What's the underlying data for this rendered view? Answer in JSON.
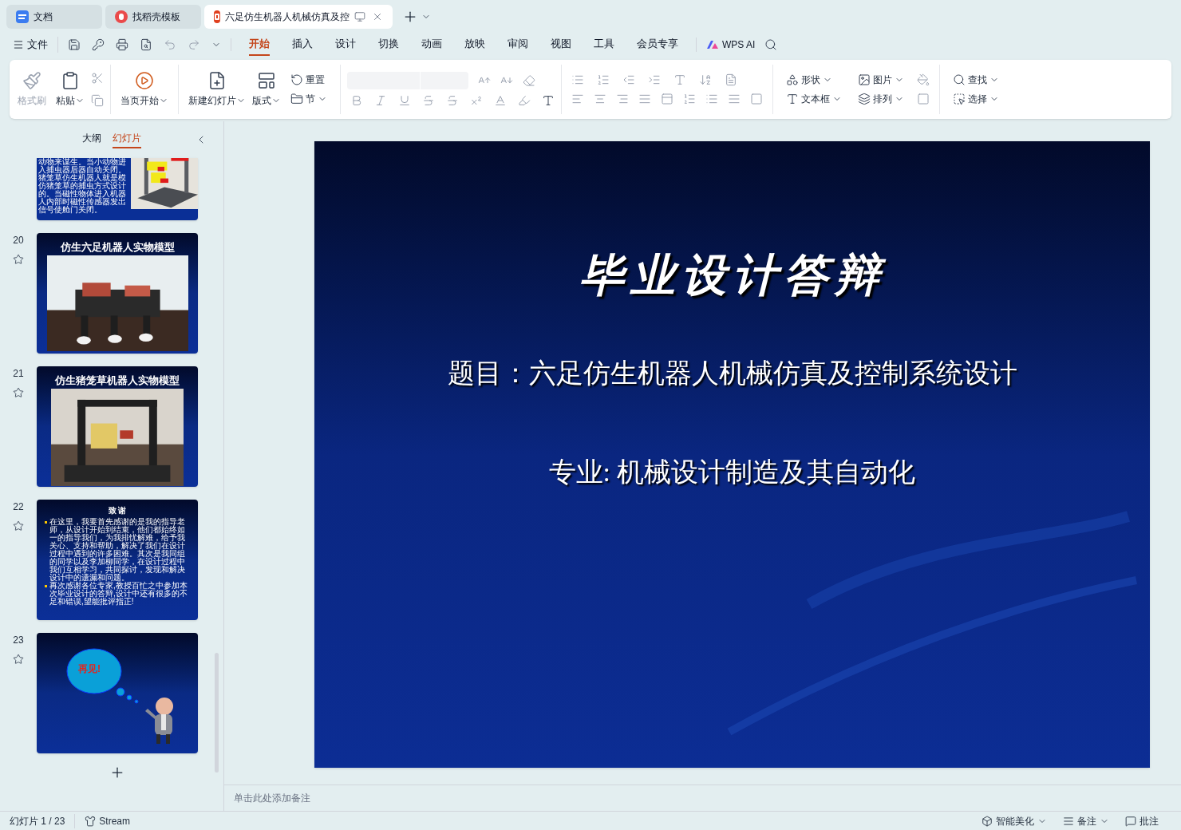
{
  "tabs": [
    {
      "label": "文档",
      "selected": false
    },
    {
      "label": "找稻壳模板",
      "selected": false
    },
    {
      "label": "六足仿生机器人机械仿真及控",
      "selected": true
    }
  ],
  "menu": {
    "file": "文件",
    "ai": "WPS AI",
    "tabs": [
      {
        "label": "开始",
        "selected": true
      },
      {
        "label": "插入",
        "selected": false
      },
      {
        "label": "设计",
        "selected": false
      },
      {
        "label": "切换",
        "selected": false
      },
      {
        "label": "动画",
        "selected": false
      },
      {
        "label": "放映",
        "selected": false
      },
      {
        "label": "审阅",
        "selected": false
      },
      {
        "label": "视图",
        "selected": false
      },
      {
        "label": "工具",
        "selected": false
      },
      {
        "label": "会员专享",
        "selected": false
      }
    ]
  },
  "ribbon": {
    "clipboard": [
      {
        "label": "格式刷",
        "disabled": true
      },
      {
        "label": "粘贴",
        "disabled": false
      }
    ],
    "play": "当页开始",
    "slides": [
      "新建幻灯片",
      "版式",
      "重置",
      "节"
    ],
    "draw": [
      "形状",
      "图片",
      "文本框",
      "排列"
    ],
    "edit": [
      "查找",
      "选择"
    ]
  },
  "panel": {
    "tabs": [
      {
        "label": "大纲",
        "selected": false
      },
      {
        "label": "幻灯片",
        "selected": true
      }
    ]
  },
  "slides": [
    {
      "kind": "text_picture",
      "text": "动物来谋生。当小动物进入捕虫器后器自动关闭。猪笼草仿生机器人就是模仿猪笼草的捕虫方式设计的。当磁性物体进入机器人内部时磁性传感器发出信号使舱门关闭。"
    },
    {
      "kind": "title_picture",
      "number": "20",
      "title": "仿生六足机器人实物模型"
    },
    {
      "kind": "title_picture",
      "number": "21",
      "title": "仿生猪笼草机器人实物模型"
    },
    {
      "kind": "thanks",
      "number": "22",
      "title": "致 谢",
      "bullets": [
        "在这里，我要首先感谢的是我的指导老师，从设计开始到结束，他们都始终如一的指导我们，为我排忧解难，给予我关心、支持和帮助，解决了我们在设计过程中遇到的许多困难。其次是我同组的同学以及李加柳同学，在设计过程中我们互相学习，共同探讨，发现和解决设计中的遗漏和问题。",
        "再次感谢各位专家,教授百忙之中参加本次毕业设计的答辩,设计中还有很多的不足和错误,望能批评指正!"
      ]
    },
    {
      "kind": "goodbye",
      "number": "23",
      "title": "再见!"
    }
  ],
  "current_slide": {
    "title": "毕业设计答辩",
    "topic": "题目：六足仿生机器人机械仿真及控制系统设计",
    "major": "专业: 机械设计制造及其自动化"
  },
  "notes": {
    "placeholder": "单击此处添加备注"
  },
  "status_bar": {
    "slide_counter": "幻灯片 1 / 23",
    "stream": "Stream",
    "beautify": "智能美化",
    "notes": "备注",
    "comments": "批注"
  }
}
